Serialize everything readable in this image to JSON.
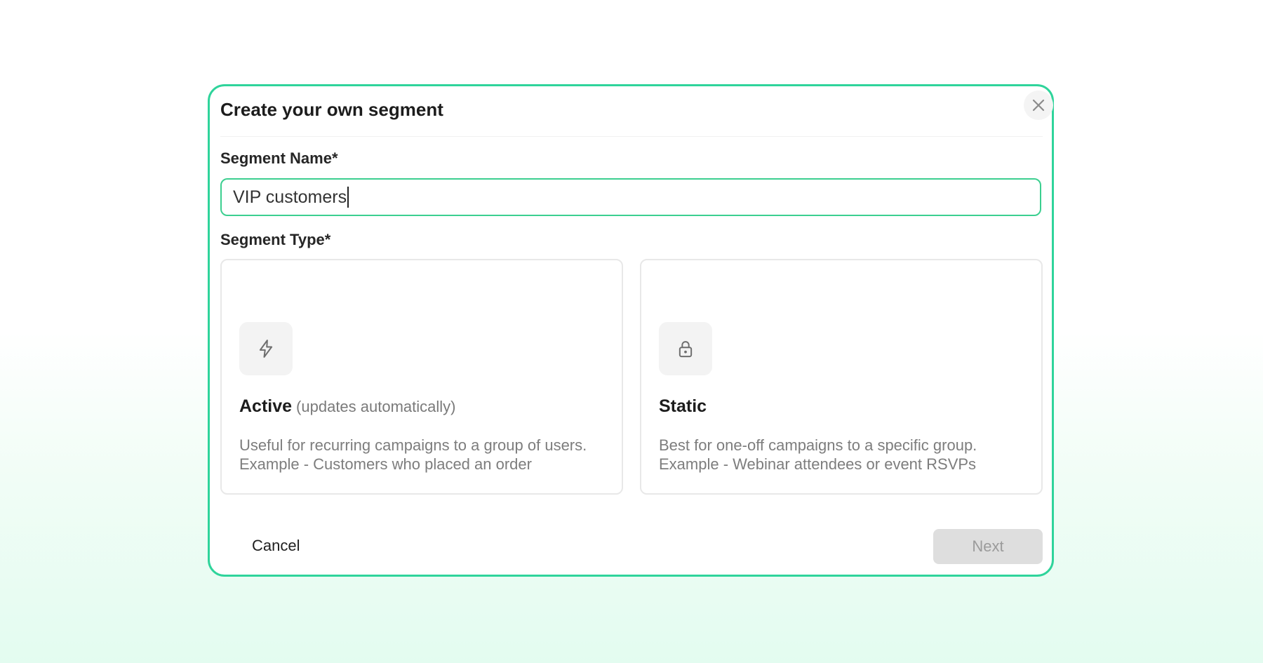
{
  "modal": {
    "title": "Create your own segment",
    "close_icon": "close-icon",
    "accent_color": "#2fd49b"
  },
  "segment_name": {
    "label": "Segment Name*",
    "value": "VIP customers"
  },
  "segment_type": {
    "label": "Segment Type*",
    "options": [
      {
        "icon": "lightning-icon",
        "title": "Active",
        "subtitle": "(updates automatically)",
        "description": "Useful for recurring campaigns to a group of users. Example - Customers who placed an order"
      },
      {
        "icon": "lock-icon",
        "title": "Static",
        "subtitle": "",
        "description": "Best for one-off campaigns to a specific group. Example - Webinar attendees or event RSVPs"
      }
    ]
  },
  "footer": {
    "cancel_label": "Cancel",
    "next_label": "Next",
    "next_disabled": true
  }
}
